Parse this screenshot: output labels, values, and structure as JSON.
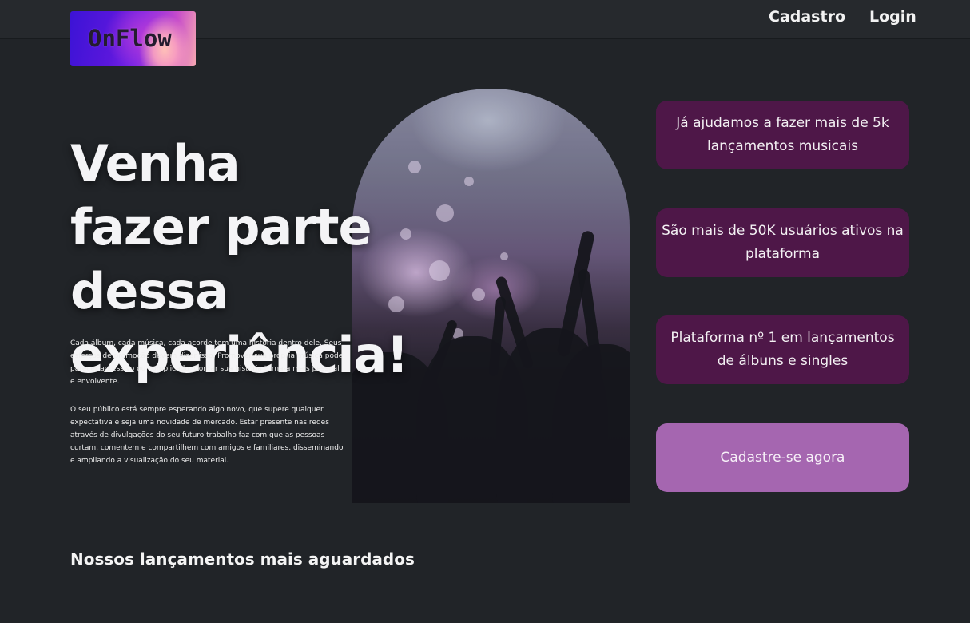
{
  "header": {
    "logo_text": "OnFlow",
    "nav": [
      {
        "label": "Cadastro"
      },
      {
        "label": "Login"
      }
    ]
  },
  "hero": {
    "title": "Venha fazer parte dessa experiência!",
    "paragraphs": [
      "Cada álbum, cada música, cada acorde tem uma história dentro dele. Seus esforços de promoção devem dizer isso. Promover sua própria música pode parecer agressivo ou complicado. Contar sua história torna-a mais pessoal e envolvente.",
      "O seu público está sempre esperando algo novo, que supere qualquer expectativa e seja uma novidade de mercado. Estar presente nas redes através de divulgações do seu futuro trabalho faz com que as pessoas curtam, comentem e compartilhem com amigos e familiares, disseminando e ampliando a visualização do seu material."
    ]
  },
  "stats": [
    {
      "text": "Já ajudamos a fazer mais de 5k lançamentos musicais"
    },
    {
      "text": "São mais de 50K usuários ativos na plataforma"
    },
    {
      "text": "Plataforma nº 1 em lançamentos de álbuns e singles"
    }
  ],
  "cta": {
    "label": "Cadastre-se agora"
  },
  "section": {
    "title": "Nossos lançamentos mais aguardados"
  },
  "colors": {
    "background": "#212428",
    "stat_card": "#4e1748",
    "cta": "#a566b0"
  }
}
